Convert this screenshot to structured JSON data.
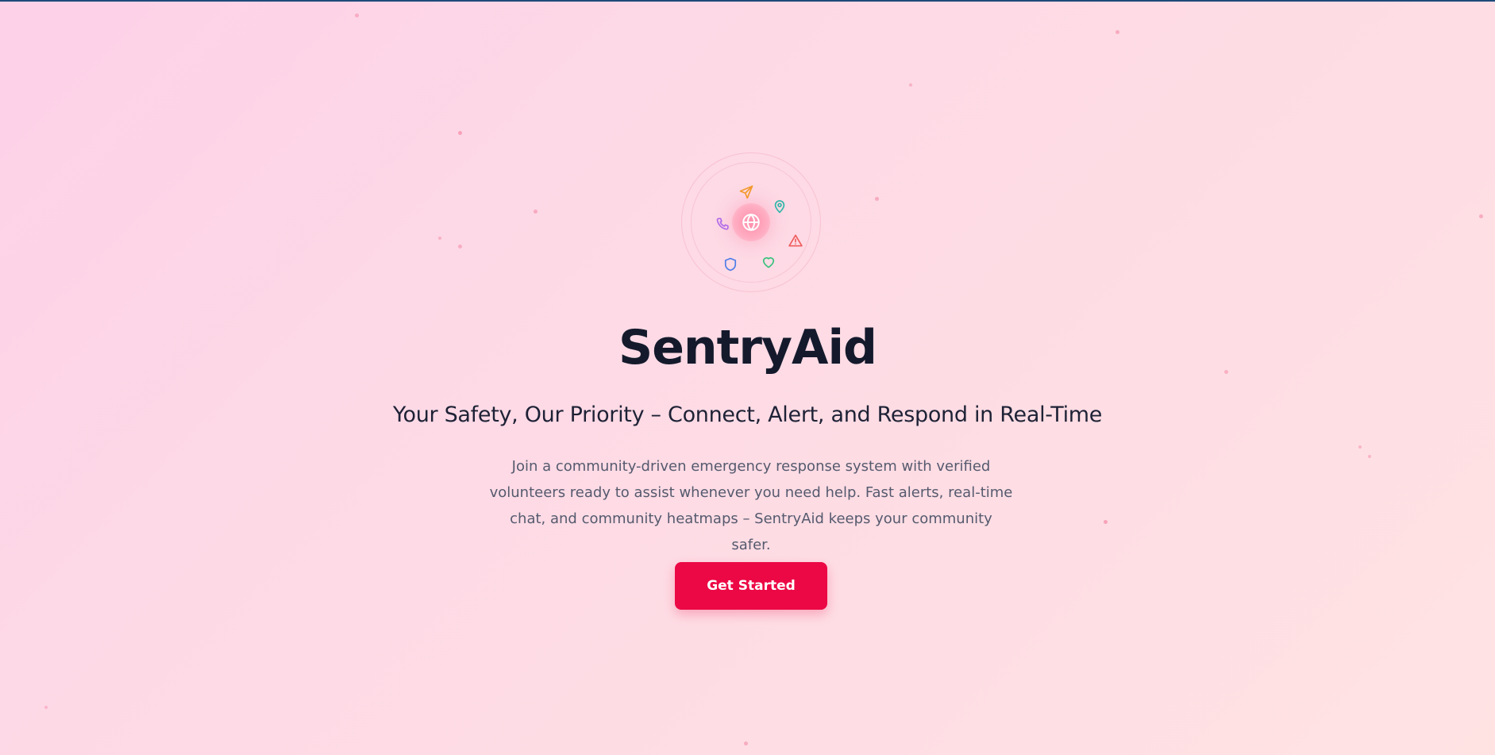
{
  "app": {
    "title": "SentryAid",
    "tagline": "Your Safety, Our Priority – Connect, Alert, and Respond in Real-Time",
    "description": "Join a community-driven emergency response system with verified volunteers ready to assist whenever you need help. Fast alerts, real-time chat, and community heatmaps – SentryAid keeps your community safer."
  },
  "cta": {
    "label": "Get Started"
  },
  "emblem": {
    "center_icon": "globe-icon",
    "orbit_icons": [
      "send-icon",
      "map-pin-icon",
      "alert-triangle-icon",
      "heart-icon",
      "shield-icon",
      "phone-icon"
    ]
  },
  "colors": {
    "accent": "#ec0845",
    "title": "#141a2c",
    "body_text": "#555a6e",
    "background_start": "#fdd1e8",
    "background_end": "#ffe3e3"
  }
}
